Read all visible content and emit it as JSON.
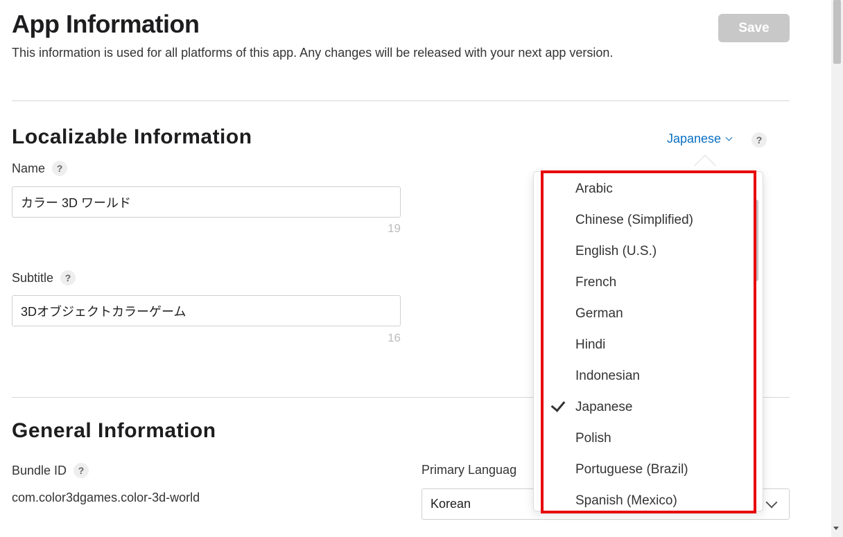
{
  "header": {
    "title": "App Information",
    "subtitle": "This information is used for all platforms of this app. Any changes will be released with your next app version.",
    "save_label": "Save"
  },
  "localizable": {
    "title": "Localizable Information",
    "language_toggle": "Japanese",
    "help": "?",
    "name": {
      "label": "Name",
      "value": "カラー 3D ワールド",
      "counter": "19"
    },
    "subtitle": {
      "label": "Subtitle",
      "value": "3Dオブジェクトカラーゲーム",
      "counter": "16"
    }
  },
  "general": {
    "title": "General Information",
    "bundle_id": {
      "label": "Bundle ID",
      "value": "com.color3dgames.color-3d-world"
    },
    "primary_language": {
      "label": "Primary Languag",
      "value": "Korean"
    }
  },
  "language_dropdown": {
    "selected": "Japanese",
    "items": [
      "Arabic",
      "Chinese (Simplified)",
      "English (U.S.)",
      "French",
      "German",
      "Hindi",
      "Indonesian",
      "Japanese",
      "Polish",
      "Portuguese (Brazil)",
      "Spanish (Mexico)"
    ]
  },
  "colors": {
    "accent": "#0a6fc2",
    "highlight": "#e8000b",
    "save_disabled": "#c8c8c8"
  }
}
